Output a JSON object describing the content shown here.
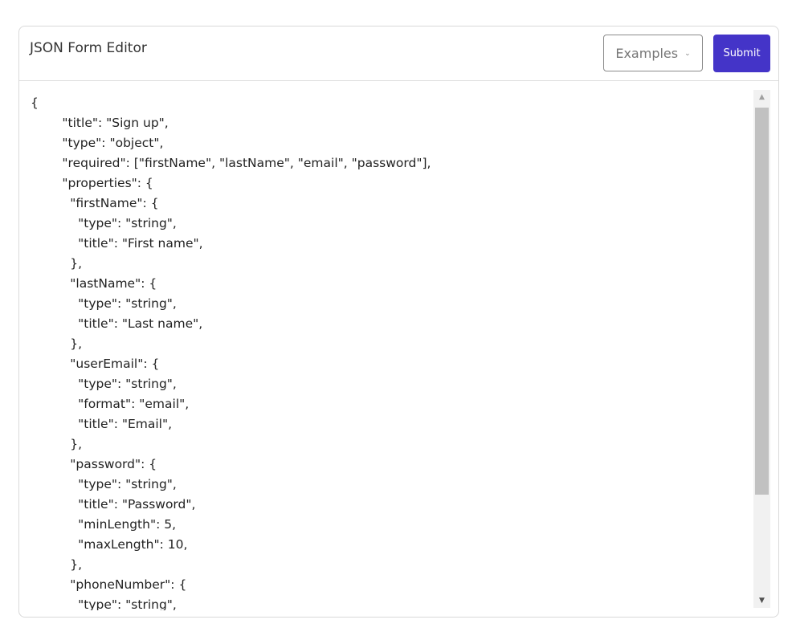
{
  "header": {
    "title": "JSON Form Editor",
    "examples_label": "Examples",
    "submit_label": "Submit"
  },
  "editor": {
    "content": "{\n\t\"title\": \"Sign up\",\n\t\"type\": \"object\",\n\t\"required\": [\"firstName\", \"lastName\", \"email\", \"password\"],\n\t\"properties\": {\n\t  \"firstName\": {\n\t    \"type\": \"string\",\n\t    \"title\": \"First name\",\n\t  },\n\t  \"lastName\": {\n\t    \"type\": \"string\",\n\t    \"title\": \"Last name\",\n\t  },\n\t  \"userEmail\": {\n\t    \"type\": \"string\",\n\t    \"format\": \"email\",\n\t    \"title\": \"Email\",\n\t  },\n\t  \"password\": {\n\t    \"type\": \"string\",\n\t    \"title\": \"Password\",\n\t    \"minLength\": 5,\n\t    \"maxLength\": 10,\n\t  },\n\t  \"phoneNumber\": {\n\t    \"type\": \"string\","
  },
  "icons": {
    "examples_chevron": "chevron-down-icon",
    "scroll_up": "arrow-up-icon",
    "scroll_down": "arrow-down-icon"
  },
  "colors": {
    "submit_bg": "#4434c8",
    "scroll_thumb": "#c1c1c1"
  }
}
